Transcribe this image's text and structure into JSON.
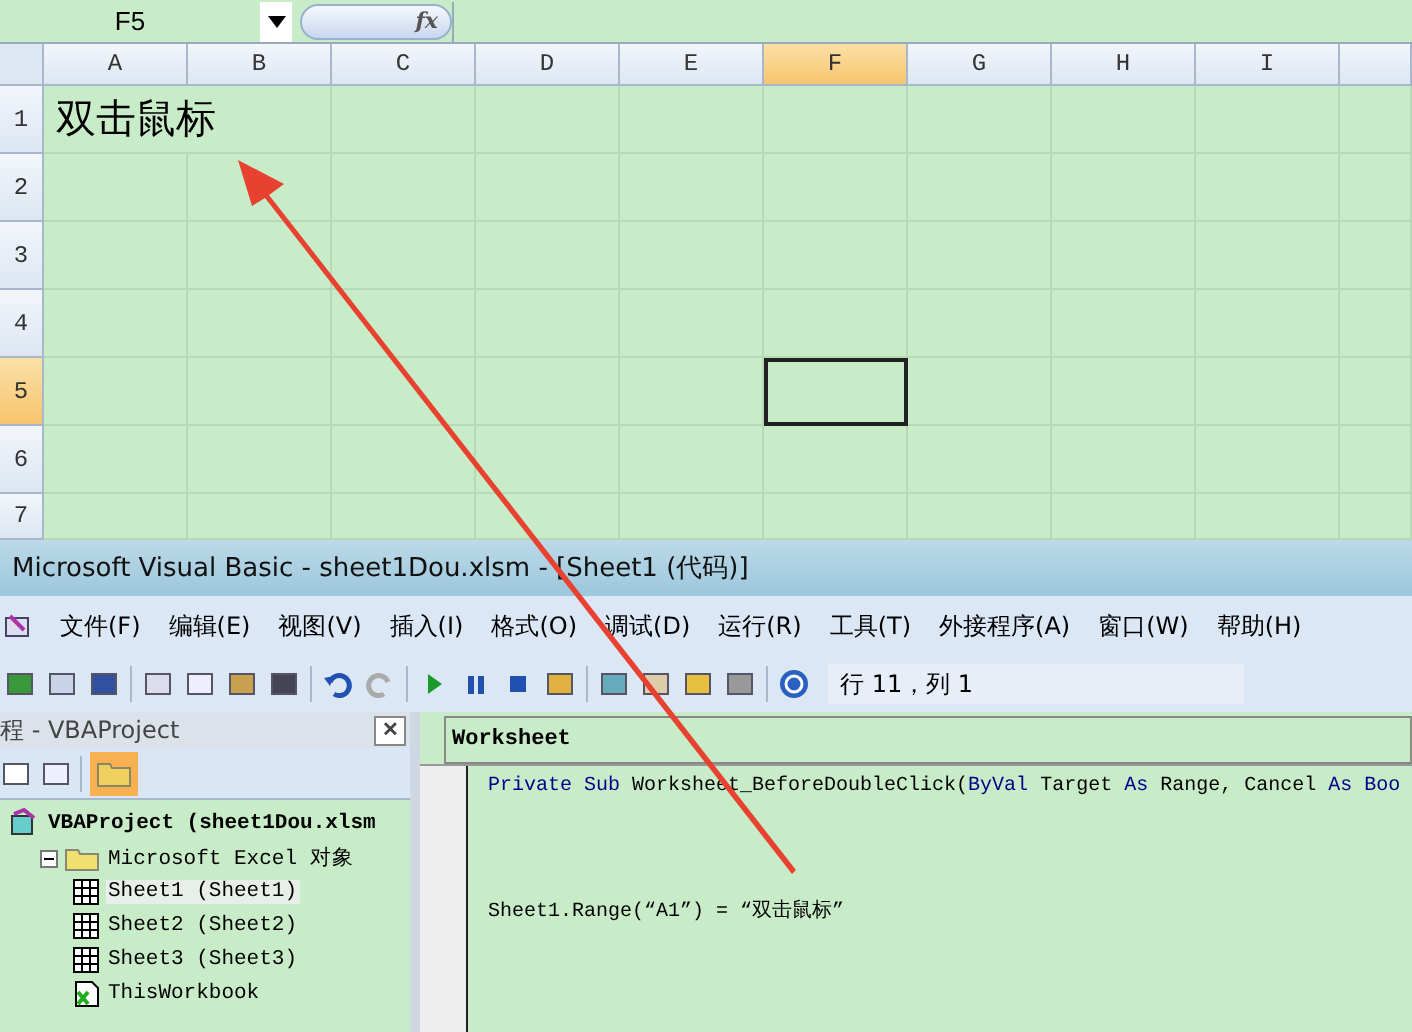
{
  "excel": {
    "name_box": "F5",
    "fx_label": "fx",
    "columns": [
      {
        "label": "A",
        "selected": false
      },
      {
        "label": "B",
        "selected": false
      },
      {
        "label": "C",
        "selected": false
      },
      {
        "label": "D",
        "selected": false
      },
      {
        "label": "E",
        "selected": false
      },
      {
        "label": "F",
        "selected": true
      },
      {
        "label": "G",
        "selected": false
      },
      {
        "label": "H",
        "selected": false
      },
      {
        "label": "I",
        "selected": false
      }
    ],
    "rows": [
      {
        "label": "1",
        "selected": false
      },
      {
        "label": "2",
        "selected": false
      },
      {
        "label": "3",
        "selected": false
      },
      {
        "label": "4",
        "selected": false
      },
      {
        "label": "5",
        "selected": true
      },
      {
        "label": "6",
        "selected": false
      },
      {
        "label": "7",
        "selected": false
      }
    ],
    "cell_a1": "双击鼠标"
  },
  "vba": {
    "title": "Microsoft Visual Basic - sheet1Dou.xlsm - [Sheet1 (代码)]",
    "menu": [
      "文件(F)",
      "编辑(E)",
      "视图(V)",
      "插入(I)",
      "格式(O)",
      "调试(D)",
      "运行(R)",
      "工具(T)",
      "外接程序(A)",
      "窗口(W)",
      "帮助(H)"
    ],
    "position": "行 11，列 1",
    "project_pane": {
      "title": "程 - VBAProject",
      "close": "✕",
      "tree": [
        {
          "label": "VBAProject (sheet1Dou.xlsm",
          "kind": "project",
          "children": [
            {
              "label": "Microsoft Excel 对象",
              "kind": "folder",
              "expanded": true,
              "children": [
                {
                  "label": "Sheet1 (Sheet1)",
                  "kind": "sheet",
                  "selected": true
                },
                {
                  "label": "Sheet2 (Sheet2)",
                  "kind": "sheet",
                  "selected": false
                },
                {
                  "label": "Sheet3 (Sheet3)",
                  "kind": "sheet",
                  "selected": false
                },
                {
                  "label": "ThisWorkbook",
                  "kind": "workbook",
                  "selected": false
                }
              ]
            }
          ]
        }
      ]
    },
    "code": {
      "object": "Worksheet",
      "lines": [
        {
          "kind": "code",
          "tokens": [
            {
              "text": "Private Sub",
              "kind": "keyword"
            },
            {
              "text": " Worksheet_BeforeDoubleClick(",
              "kind": "plain"
            },
            {
              "text": "ByVal",
              "kind": "keyword"
            },
            {
              "text": " Target ",
              "kind": "plain"
            },
            {
              "text": "As",
              "kind": "keyword"
            },
            {
              "text": " Range, Cancel ",
              "kind": "plain"
            },
            {
              "text": "As Boo",
              "kind": "keyword"
            }
          ]
        },
        {
          "kind": "blank"
        },
        {
          "kind": "blank"
        },
        {
          "kind": "blank"
        },
        {
          "kind": "code",
          "tokens": [
            {
              "text": "Sheet1.Range(“A1”) = “双击鼠标”",
              "kind": "plain"
            }
          ]
        }
      ]
    }
  }
}
